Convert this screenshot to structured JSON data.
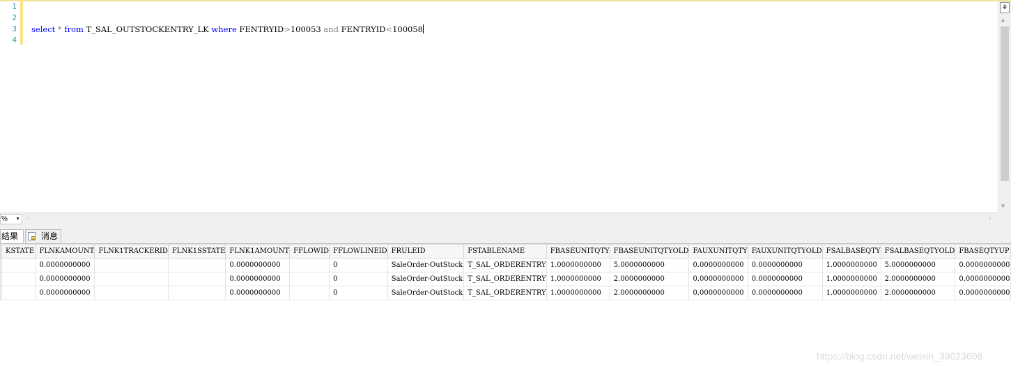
{
  "editor": {
    "line_numbers": [
      "1",
      "2",
      "3",
      "4"
    ],
    "query_tokens": [
      {
        "text": "select",
        "kind": "kw"
      },
      {
        "text": " ",
        "kind": "plain"
      },
      {
        "text": "*",
        "kind": "op"
      },
      {
        "text": " ",
        "kind": "plain"
      },
      {
        "text": "from",
        "kind": "kw"
      },
      {
        "text": " T_SAL_OUTSTOCKENTRY_LK ",
        "kind": "plain"
      },
      {
        "text": "where",
        "kind": "kw"
      },
      {
        "text": " FENTRYID",
        "kind": "plain"
      },
      {
        "text": ">",
        "kind": "op"
      },
      {
        "text": "100053 ",
        "kind": "plain"
      },
      {
        "text": "and",
        "kind": "op"
      },
      {
        "text": " FENTRYID",
        "kind": "plain"
      },
      {
        "text": "<",
        "kind": "op"
      },
      {
        "text": "100058",
        "kind": "plain"
      }
    ]
  },
  "zoom": {
    "value": "%"
  },
  "tabs": {
    "results": "结果",
    "messages": "消息"
  },
  "grid": {
    "columns": [
      "KSTATE",
      "FLNKAMOUNT",
      "FLNK1TRACKERID",
      "FLNK1SSTATE",
      "FLNK1AMOUNT",
      "FFLOWID",
      "FFLOWLINEID",
      "FRULEID",
      "FSTABLENAME",
      "FBASEUNITQTY",
      "FBASEUNITQTYOLD",
      "FAUXUNITQTY",
      "FAUXUNITQTYOLD",
      "FSALBASEQTY",
      "FSALBASEQTYOLD",
      "FBASEQTYUP"
    ],
    "rows": [
      [
        "",
        "0.0000000000",
        "",
        "",
        "0.0000000000",
        "",
        "0",
        "SaleOrder-OutStock",
        "T_SAL_ORDERENTRY",
        "1.0000000000",
        "5.0000000000",
        "0.0000000000",
        "0.0000000000",
        "1.0000000000",
        "5.0000000000",
        "0.0000000000"
      ],
      [
        "",
        "0.0000000000",
        "",
        "",
        "0.0000000000",
        "",
        "0",
        "SaleOrder-OutStock",
        "T_SAL_ORDERENTRY",
        "1.0000000000",
        "2.0000000000",
        "0.0000000000",
        "0.0000000000",
        "1.0000000000",
        "2.0000000000",
        "0.0000000000"
      ],
      [
        "",
        "0.0000000000",
        "",
        "",
        "0.0000000000",
        "",
        "0",
        "SaleOrder-OutStock",
        "T_SAL_ORDERENTRY",
        "1.0000000000",
        "2.0000000000",
        "0.0000000000",
        "0.0000000000",
        "1.0000000000",
        "2.0000000000",
        "0.0000000000"
      ]
    ]
  },
  "watermark": "https://blog.csdn.net/weixin_39023606"
}
